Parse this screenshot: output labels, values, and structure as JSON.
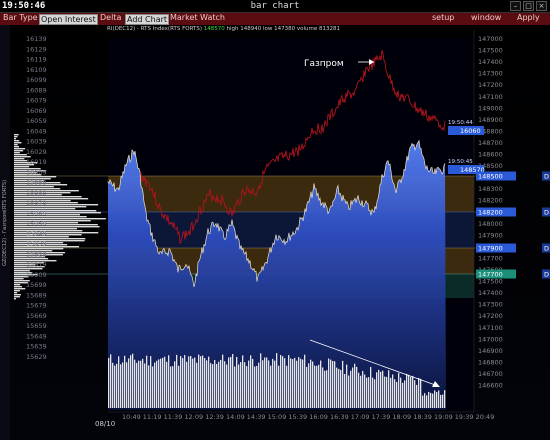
{
  "window": {
    "clock": "19:50:46",
    "title": "bar chart"
  },
  "menu": {
    "bar_type": "Bar Type",
    "open_interest": "Open Interest",
    "delta": "Delta",
    "add_chart": "Add Chart",
    "market_watch": "Market Watch",
    "setup": "setup",
    "window": "window",
    "apply": "Apply"
  },
  "colors": {
    "menu_bg": "#5a0c10",
    "price_fill": "#3a5cd8",
    "gazprom_line": "#b0141c",
    "zone_gold": "#7a5a1a",
    "zone_teal": "#1b5a4a",
    "volume": "#e6e6e6"
  },
  "header": {
    "instrument": "RI(DEC12) - RTS Index(RTS FORTS)",
    "last": "148570",
    "high_label": "high 148940",
    "low_label": "low 147380",
    "volume_label": "volume 813281"
  },
  "left_axis_label": "GZ(DEC12) - Газпром(RTS FORTS)",
  "left_axis": [
    "16139",
    "16129",
    "16119",
    "16109",
    "16099",
    "16089",
    "16079",
    "16069",
    "16059",
    "16049",
    "16039",
    "16029",
    "16019",
    "16009",
    "15999",
    "15989",
    "15979",
    "15969",
    "15959",
    "15949",
    "15939",
    "15929",
    "15919",
    "15909",
    "15699",
    "15689",
    "15679",
    "15669",
    "15659",
    "15649",
    "15639",
    "15629"
  ],
  "right_axis": [
    "147000",
    "146900",
    "147500",
    "147400",
    "147300",
    "147200",
    "147100",
    "149000",
    "148900",
    "148800",
    "148700",
    "148600",
    "148500",
    "148400",
    "148300",
    "148200",
    "148100",
    "148000",
    "147900",
    "147800",
    "147700",
    "147600",
    "147500",
    "147400",
    "147300",
    "147200",
    "147100",
    "147000",
    "146900",
    "146800",
    "146700",
    "146600"
  ],
  "right_axis_visible": [
    "147000",
    "147500",
    "147400",
    "147300",
    "147200",
    "147100",
    "149000",
    "148900",
    "148800",
    "148700",
    "148600",
    "148500",
    "148400",
    "148300",
    "148200",
    "148100",
    "148000",
    "147900",
    "147800",
    "147700",
    "147600",
    "147500",
    "147400",
    "147300",
    "147200",
    "147100",
    "147000",
    "146900",
    "146800",
    "146700",
    "146600"
  ],
  "x_axis": [
    "10:49",
    "11:19",
    "11:39",
    "12:09",
    "12:39",
    "14:09",
    "14:39",
    "15:09",
    "15:39",
    "16:09",
    "16:39",
    "17:09",
    "17:39",
    "18:09",
    "18:39",
    "19:09",
    "19:39",
    "20:49"
  ],
  "date_label": "08/10",
  "annotation": "Газпром",
  "price_tags": [
    {
      "time": "19:50:44",
      "value": "16060",
      "color": "#2a5ad8"
    },
    {
      "time": "19:50:45",
      "value": "148570",
      "color": "#2a5ad8"
    }
  ],
  "level_tags": [
    {
      "value": "148500",
      "color": "#2a5ad8"
    },
    {
      "value": "148200",
      "color": "#2a5ad8"
    },
    {
      "value": "147900",
      "color": "#2a5ad8"
    },
    {
      "value": "147700",
      "color": "#1b8f7a"
    }
  ]
}
